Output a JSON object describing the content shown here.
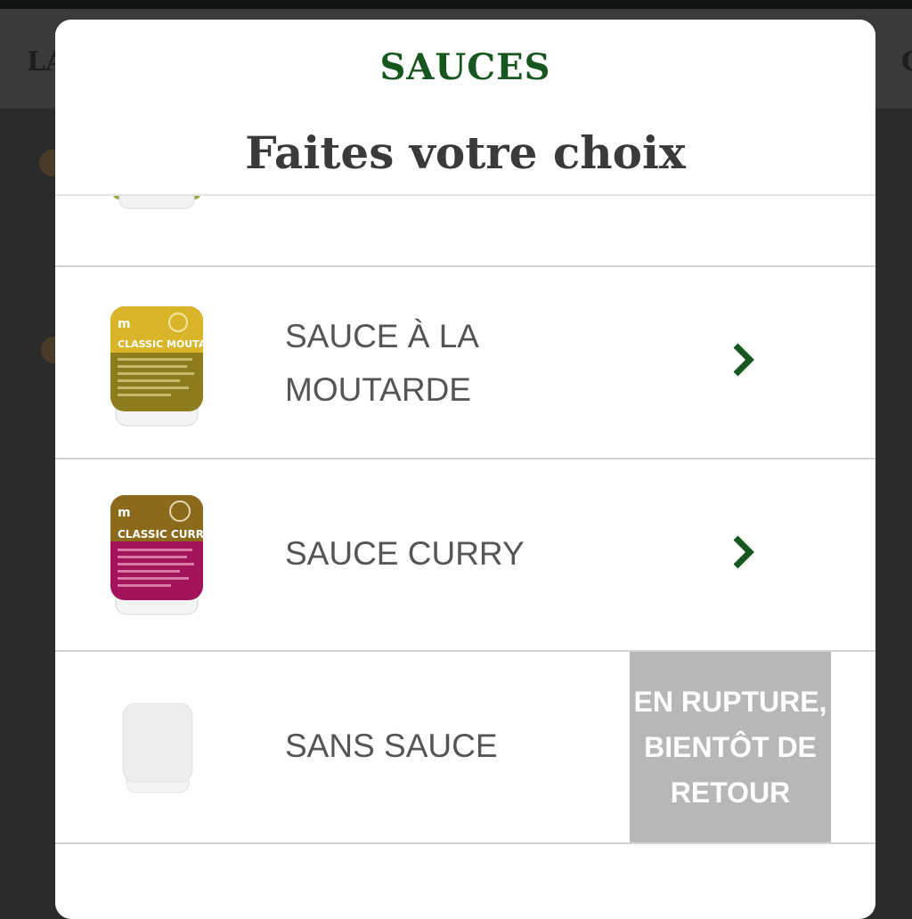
{
  "background": {
    "left_label": "LA",
    "right_label": "C"
  },
  "modal": {
    "title": "SAUCES",
    "subtitle": "Faites votre choix",
    "colors": {
      "title": "#17561f",
      "subtitle": "#3a3a3a",
      "chevron": "#17561f",
      "out_of_stock_bg": "#b7b7b7"
    }
  },
  "items": [
    {
      "label": "",
      "icon": "green-sauce-packet-icon"
    },
    {
      "label": "SAUCE À LA\nMOUTARDE",
      "icon": "mustard-sauce-packet-icon",
      "packet_text": "CLASSIC MOUTARDE",
      "chevron": "chevron-right-icon"
    },
    {
      "label": "SAUCE CURRY",
      "icon": "curry-sauce-packet-icon",
      "packet_text": "CLASSIC CURRY",
      "chevron": "chevron-right-icon"
    },
    {
      "label": "SANS SAUCE",
      "icon": "empty-packet-icon",
      "status": "EN RUPTURE,\nBIENTÔT DE\nRETOUR"
    }
  ]
}
